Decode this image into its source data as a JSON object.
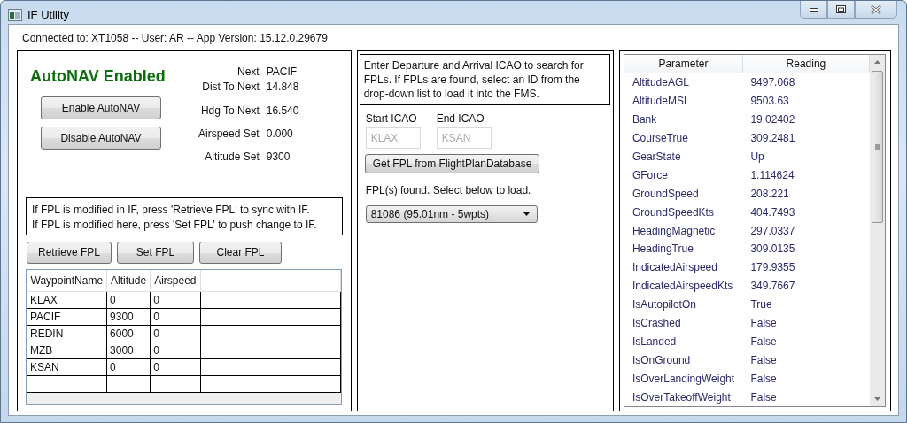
{
  "window": {
    "title": "IF Utility"
  },
  "status": "Connected to: XT1058 -- User: AR -- App Version: 15.12.0.29679",
  "autonav": {
    "heading": "AutoNAV Enabled",
    "enabled": true,
    "buttons": [
      "Enable AutoNAV",
      "Disable AutoNAV"
    ],
    "info": [
      {
        "label": "Next",
        "value": "PACIF"
      },
      {
        "label": "Dist To Next",
        "value": "14.848"
      },
      {
        "label": "Hdg To Next",
        "value": "16.540"
      },
      {
        "label": "Airspeed Set",
        "value": "0.000"
      },
      {
        "label": "Altitude Set",
        "value": "9300"
      }
    ]
  },
  "fpl_note": [
    "If FPL is modified in IF, press 'Retrieve FPL' to sync with IF.",
    "If FPL is modified here, press 'Set FPL' to push change to IF."
  ],
  "fpl_buttons": [
    "Retrieve FPL",
    "Set FPL",
    "Clear FPL"
  ],
  "waypoints": {
    "columns": [
      "WaypointName",
      "Altitude",
      "Airspeed"
    ],
    "rows": [
      [
        "KLAX",
        "0",
        "0"
      ],
      [
        "PACIF",
        "9300",
        "0"
      ],
      [
        "REDIN",
        "6000",
        "0"
      ],
      [
        "MZB",
        "3000",
        "0"
      ],
      [
        "KSAN",
        "0",
        "0"
      ]
    ]
  },
  "search": {
    "instructions": "Enter Departure and Arrival ICAO to search for FPLs. If FPLs are found, select an ID from the drop-down list to load it into the FMS.",
    "fields": [
      {
        "label": "Start ICAO",
        "placeholder": "KLAX"
      },
      {
        "label": "End ICAO",
        "placeholder": "KSAN"
      }
    ],
    "button": "Get FPL from FlightPlanDatabase",
    "result": "FPL(s) found. Select below to load.",
    "dropdown": "81086 (95.01nm - 5wpts)"
  },
  "readings": {
    "columns": [
      "Parameter",
      "Reading"
    ],
    "rows": [
      [
        "AltitudeAGL",
        "9497.068"
      ],
      [
        "AltitudeMSL",
        "9503.63"
      ],
      [
        "Bank",
        "19.02402"
      ],
      [
        "CourseTrue",
        "309.2481"
      ],
      [
        "GearState",
        "Up"
      ],
      [
        "GForce",
        "1.114624"
      ],
      [
        "GroundSpeed",
        "208.221"
      ],
      [
        "GroundSpeedKts",
        "404.7493"
      ],
      [
        "HeadingMagnetic",
        "297.0337"
      ],
      [
        "HeadingTrue",
        "309.0135"
      ],
      [
        "IndicatedAirspeed",
        "179.9355"
      ],
      [
        "IndicatedAirspeedKts",
        "349.7667"
      ],
      [
        "IsAutopilotOn",
        "True"
      ],
      [
        "IsCrashed",
        "False"
      ],
      [
        "IsLanded",
        "False"
      ],
      [
        "IsOnGround",
        "False"
      ],
      [
        "IsOverLandingWeight",
        "False"
      ],
      [
        "IsOverTakeoffWeight",
        "False"
      ]
    ]
  }
}
